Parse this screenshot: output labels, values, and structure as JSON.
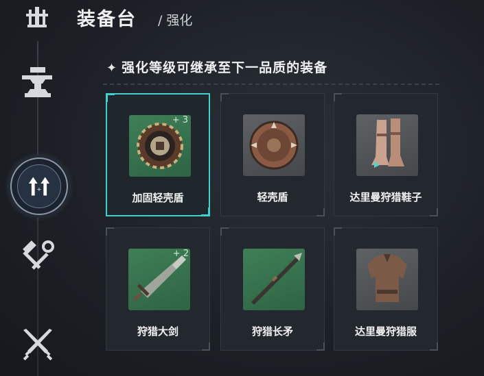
{
  "header": {
    "title": "装备台",
    "breadcrumb_sep": "/",
    "breadcrumb": "强化",
    "back_icon": "tower-icon"
  },
  "sidebar": {
    "items": [
      {
        "icon": "anvil-icon",
        "active": false
      },
      {
        "icon": "upgrade-arrows-icon",
        "active": true
      },
      {
        "icon": "hammer-wrench-icon",
        "active": false
      },
      {
        "icon": "crossed-swords-icon",
        "active": false
      }
    ]
  },
  "notice": {
    "star": "✦",
    "text": "强化等级可继承至下一品质的装备"
  },
  "items": [
    {
      "name": "加固轻壳盾",
      "level": "+ 3",
      "bg": "green",
      "icon": "shield-icon",
      "selected": true
    },
    {
      "name": "轻壳盾",
      "level": "",
      "bg": "grey",
      "icon": "shield-icon",
      "selected": false
    },
    {
      "name": "达里曼狩猎鞋子",
      "level": "",
      "bg": "grey",
      "icon": "boots-icon",
      "selected": false
    },
    {
      "name": "狩猎大剑",
      "level": "+ 2",
      "bg": "green",
      "icon": "greatsword-icon",
      "selected": false
    },
    {
      "name": "狩猎长矛",
      "level": "",
      "bg": "green",
      "icon": "spear-icon",
      "selected": false
    },
    {
      "name": "达里曼狩猎服",
      "level": "",
      "bg": "grey",
      "icon": "armor-icon",
      "selected": false
    }
  ],
  "colors": {
    "accent": "#3fd0cf",
    "background": "#1d2127",
    "card": "#23282f",
    "thumb_green": "#3f7f57",
    "thumb_grey": "#5a5d60"
  }
}
